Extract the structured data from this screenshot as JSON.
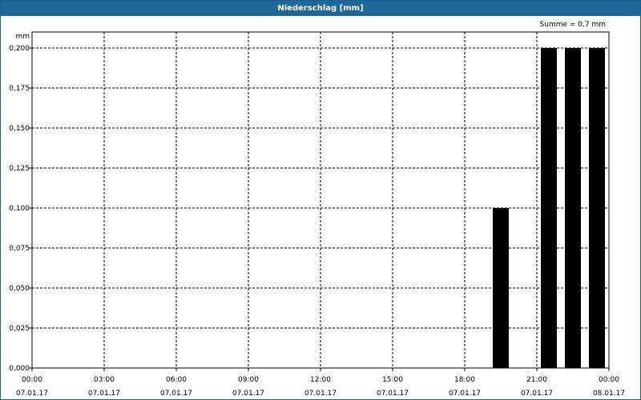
{
  "window": {
    "title": "Niederschlag [mm]"
  },
  "summary": {
    "text": "Summe = 0,7 mm"
  },
  "chart_data": {
    "type": "bar",
    "title": "Niederschlag [mm]",
    "ylabel": "mm",
    "xlabel": "",
    "ylim": [
      0,
      0.2
    ],
    "yticks": [
      "0,000",
      "0,025",
      "0,050",
      "0,075",
      "0,100",
      "0,125",
      "0,150",
      "0,175",
      "0,200"
    ],
    "xlim_hours": [
      0,
      24
    ],
    "xticks": [
      {
        "time": "00:00",
        "date": "07.01.17"
      },
      {
        "time": "03:00",
        "date": "07.01.17"
      },
      {
        "time": "06:00",
        "date": "07.01.17"
      },
      {
        "time": "09:00",
        "date": "07.01.17"
      },
      {
        "time": "12:00",
        "date": "07.01.17"
      },
      {
        "time": "15:00",
        "date": "07.01.17"
      },
      {
        "time": "18:00",
        "date": "07.01.17"
      },
      {
        "time": "21:00",
        "date": "07.01.17"
      },
      {
        "time": "00:00",
        "date": "08.01.17"
      }
    ],
    "bars": [
      {
        "x": "07.01.17 19:00",
        "value": 0.1
      },
      {
        "x": "07.01.17 21:00",
        "value": 0.2
      },
      {
        "x": "07.01.17 22:00",
        "value": 0.2
      },
      {
        "x": "07.01.17 23:00",
        "value": 0.2
      }
    ],
    "grid": true,
    "bar_color": "#000000"
  }
}
